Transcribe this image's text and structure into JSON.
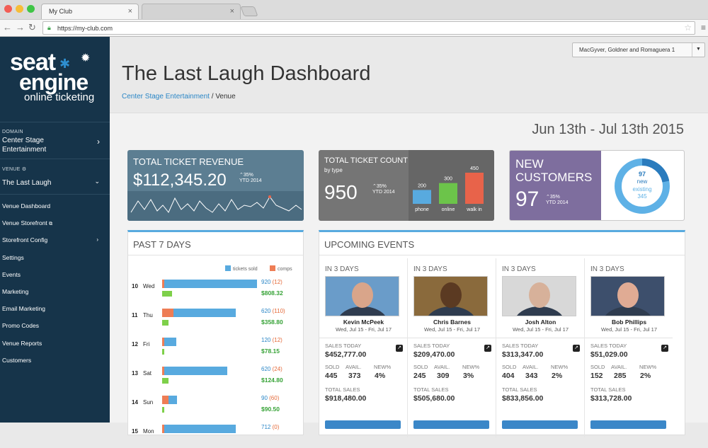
{
  "browser": {
    "tab1": "My Club",
    "url": "https://my-club.com"
  },
  "brand": {
    "line1": "seat",
    "line2": "engine",
    "line3": "online ticketing"
  },
  "sidebar": {
    "domain_label": "DOMAIN",
    "domain_value": "Center Stage Entertainment",
    "venue_label": "VENUE",
    "venue_value": "The Last Laugh",
    "items": [
      "Venue Dashboard",
      "Venue Storefront",
      "Storefront Config",
      "Settings",
      "Events",
      "Marketing",
      "Email Marketing",
      "Promo Codes",
      "Venue Reports",
      "Customers"
    ]
  },
  "header": {
    "title": "The Last Laugh Dashboard",
    "crumb_link": "Center Stage Entertainment",
    "crumb_sep": "/",
    "crumb_current": "Venue",
    "org_select": "MacGyver, Goldner and Romaguera 1"
  },
  "date_range": "Jun 13th - Jul 13th 2015",
  "revenue": {
    "title": "TOTAL TICKET REVENUE",
    "value": "$112,345.20",
    "pct": "35%",
    "ytd": "YTD 2014"
  },
  "count": {
    "title": "TOTAL TICKET COUNT",
    "subtitle": "by type",
    "value": "950",
    "pct": "35%",
    "ytd": "YTD 2014",
    "bars": [
      {
        "label": "phone",
        "value": 200,
        "color": "#58aadf"
      },
      {
        "label": "online",
        "value": 300,
        "color": "#6cc44a"
      },
      {
        "label": "walk in",
        "value": 450,
        "color": "#e8634a"
      }
    ]
  },
  "customers": {
    "title": "NEW CUSTOMERS",
    "value": "97",
    "pct": "35%",
    "ytd": "YTD 2014",
    "ring_top": "97",
    "ring_new": "new",
    "ring_existing": "existing",
    "ring_exist_val": "345",
    "new_fraction": 0.219
  },
  "past7": {
    "title": "PAST 7 DAYS",
    "legend_sold": "tickets sold",
    "legend_comps": "comps",
    "rows": [
      {
        "day": "10",
        "dow": "Wed",
        "sold": 920,
        "comps": 12,
        "sold_txt": "920",
        "comps_txt": "(12)",
        "money": "$808.32"
      },
      {
        "day": "11",
        "dow": "Thu",
        "sold": 620,
        "comps": 110,
        "sold_txt": "620",
        "comps_txt": "(110)",
        "money": "$358.80"
      },
      {
        "day": "12",
        "dow": "Fri",
        "sold": 120,
        "comps": 12,
        "sold_txt": "120",
        "comps_txt": "(12)",
        "money": "$78.15"
      },
      {
        "day": "13",
        "dow": "Sat",
        "sold": 620,
        "comps": 24,
        "sold_txt": "620",
        "comps_txt": "(24)",
        "money": "$124.80"
      },
      {
        "day": "14",
        "dow": "Sun",
        "sold": 90,
        "comps": 60,
        "sold_txt": "90",
        "comps_txt": "(60)",
        "money": "$90.50"
      },
      {
        "day": "15",
        "dow": "Mon",
        "sold": 712,
        "comps": 0,
        "sold_txt": "712",
        "comps_txt": "(0)",
        "money": ""
      }
    ]
  },
  "upcoming": {
    "title": "UPCOMING EVENTS",
    "labels": {
      "sales_today": "SALES TODAY",
      "sold": "SOLD",
      "avail": "AVAIL.",
      "newpct": "NEW%",
      "total": "TOTAL SALES"
    },
    "events": [
      {
        "in": "IN 3 DAYS",
        "name": "Kevin McPeek",
        "dates": "Wed, Jul 15 - Fri, Jul 17",
        "sales_today": "$452,777.00",
        "sold": "445",
        "avail": "373",
        "newpct": "4%",
        "total": "$918,480.00",
        "bg": "#6a9cc9",
        "skin": "#d9a58a"
      },
      {
        "in": "IN 3 DAYS",
        "name": "Chris Barnes",
        "dates": "Wed, Jul 15 - Fri, Jul 17",
        "sales_today": "$209,470.00",
        "sold": "245",
        "avail": "309",
        "newpct": "3%",
        "total": "$505,680.00",
        "bg": "#8a6a3c",
        "skin": "#5b3a22"
      },
      {
        "in": "IN 3 DAYS",
        "name": "Josh Alton",
        "dates": "Wed, Jul 15 - Fri, Jul 17",
        "sales_today": "$313,347.00",
        "sold": "404",
        "avail": "343",
        "newpct": "2%",
        "total": "$833,856.00",
        "bg": "#d8d8d8",
        "skin": "#d7b19a"
      },
      {
        "in": "IN 3 DAYS",
        "name": "Bob Phillips",
        "dates": "Wed, Jul 15 - Fri, Jul 17",
        "sales_today": "$51,029.00",
        "sold": "152",
        "avail": "285",
        "newpct": "2%",
        "total": "$313,728.00",
        "bg": "#3d4f6c",
        "skin": "#e0ab94"
      }
    ]
  }
}
